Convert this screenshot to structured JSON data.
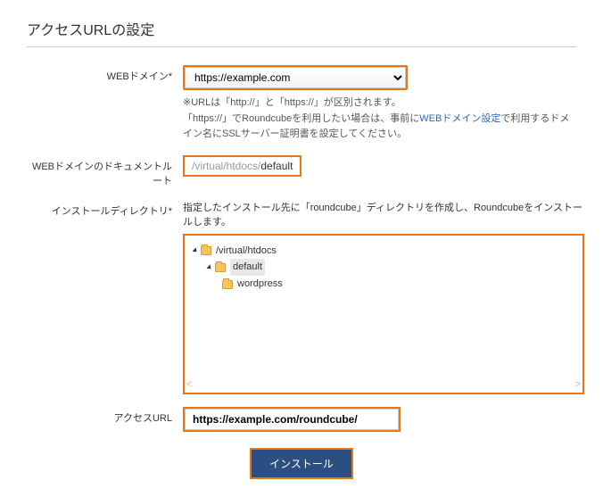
{
  "title": "アクセスURLの設定",
  "fields": {
    "domain_label": "WEBドメイン*",
    "domain_value": "https://example.com",
    "help1": "※URLは「http://」と「https://」が区別されます。",
    "help2a": "「https://」でRoundcubeを利用したい場合は、事前に",
    "help2_link": "WEBドメイン設定",
    "help2b": "で利用するドメイン名にSSLサーバー証明書を設定してください。",
    "docroot_label": "WEBドメインのドキュメントルート",
    "docroot_gray": "/virtual/htdocs/",
    "docroot_bold": "default",
    "installdir_label": "インストールディレクトリ*",
    "installdir_desc": "指定したインストール先に「roundcube」ディレクトリを作成し、Roundcubeをインストールします。",
    "tree": {
      "root": "/virtual/htdocs",
      "child1": "default",
      "child2": "wordpress"
    },
    "accessurl_label": "アクセスURL",
    "accessurl_value": "https://example.com/roundcube/",
    "install_btn": "インストール"
  }
}
